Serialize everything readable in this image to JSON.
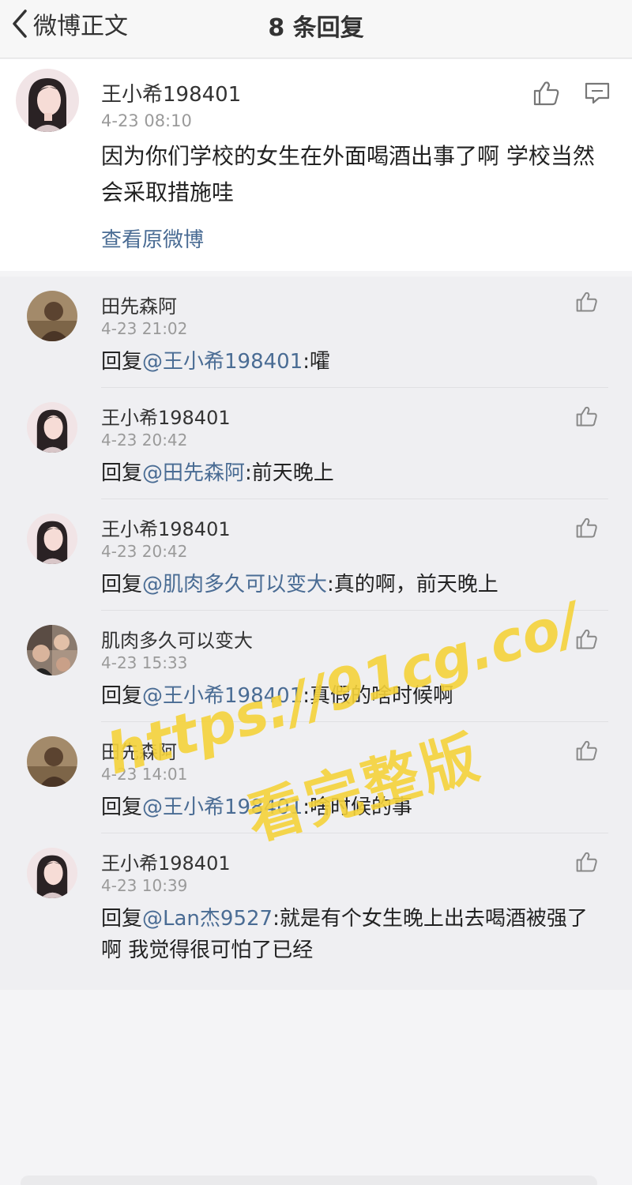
{
  "nav": {
    "back_label": "微博正文",
    "title": "8 条回复"
  },
  "main_post": {
    "username": "王小希198401",
    "time": "4-23 08:10",
    "text": "因为你们学校的女生在外面喝酒出事了啊  学校当然会采取措施哇",
    "view_original": "查看原微博",
    "avatar_icon": "girl-portrait",
    "like_icon": "thumbs-up-icon",
    "comment_icon": "comment-icon"
  },
  "replies": [
    {
      "username": "田先森阿",
      "time": "4-23 21:02",
      "prefix": "回复",
      "mention": "@王小希198401",
      "text": ":嚯",
      "avatar_icon": "man-portrait"
    },
    {
      "username": "王小希198401",
      "time": "4-23 20:42",
      "prefix": "回复",
      "mention": "@田先森阿",
      "text": ":前天晚上",
      "avatar_icon": "girl-portrait"
    },
    {
      "username": "王小希198401",
      "time": "4-23 20:42",
      "prefix": "回复",
      "mention": "@肌肉多久可以变大",
      "text": ":真的啊，前天晚上",
      "avatar_icon": "girl-portrait"
    },
    {
      "username": "肌肉多久可以变大",
      "time": "4-23 15:33",
      "prefix": "回复",
      "mention": "@王小希198401",
      "text": ":真假的啥时候啊",
      "avatar_icon": "group-photo"
    },
    {
      "username": "田先森阿",
      "time": "4-23 14:01",
      "prefix": "回复",
      "mention": "@王小希198401",
      "text": ":啥时候的事",
      "avatar_icon": "man-portrait"
    },
    {
      "username": "王小希198401",
      "time": "4-23 10:39",
      "prefix": "回复",
      "mention": "@Lan杰9527",
      "text": ":就是有个女生晚上出去喝酒被强了啊  我觉得很可怕了已经",
      "avatar_icon": "girl-portrait"
    }
  ],
  "watermark": {
    "url": "https://91cg.co/",
    "text": "看完整版"
  },
  "colors": {
    "mention": "#4a6c94",
    "watermark": "#f5d33b",
    "background": "#efeff2"
  }
}
